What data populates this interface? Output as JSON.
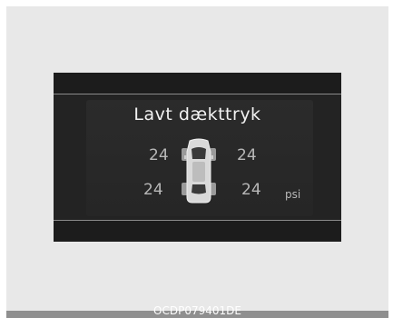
{
  "display": {
    "title": "Lavt dækttryk",
    "front_left": "24",
    "front_right": "24",
    "rear_left": "24",
    "rear_right": "24",
    "unit": "psi"
  },
  "caption": "OCDP079401DE",
  "icons": {
    "car": "car-top-view-icon"
  },
  "colors": {
    "screen_bg": "#232323",
    "text": "#b8b8b8",
    "frame": "#e8e8e8"
  }
}
